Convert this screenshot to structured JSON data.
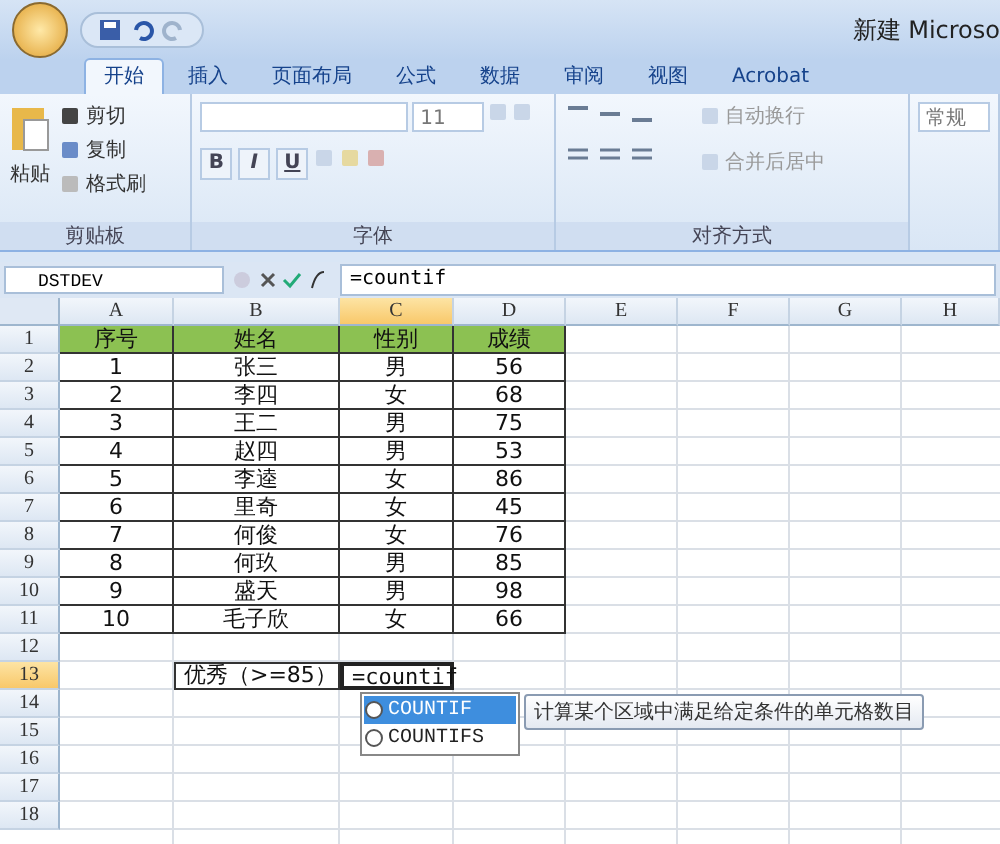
{
  "title_bar": {
    "title": "新建 Microso"
  },
  "tabs": [
    {
      "label": "开始",
      "selected": true
    },
    {
      "label": "插入",
      "selected": false
    },
    {
      "label": "页面布局",
      "selected": false
    },
    {
      "label": "公式",
      "selected": false
    },
    {
      "label": "数据",
      "selected": false
    },
    {
      "label": "审阅",
      "selected": false
    },
    {
      "label": "视图",
      "selected": false
    },
    {
      "label": "Acrobat",
      "selected": false
    }
  ],
  "ribbon": {
    "clipboard": {
      "paste": "粘贴",
      "items": [
        "剪切",
        "复制",
        "格式刷"
      ],
      "label": "剪贴板"
    },
    "font": {
      "size": "11",
      "format_buttons": [
        "B",
        "I",
        "U"
      ],
      "label": "字体"
    },
    "alignment": {
      "wrap": "自动换行",
      "merge": "合并后居中",
      "label": "对齐方式"
    },
    "number": {
      "format": "常规"
    }
  },
  "formula_bar": {
    "name_box": "DSTDEV",
    "formula": "=countif"
  },
  "columns": [
    {
      "label": "A",
      "selected": false
    },
    {
      "label": "B",
      "selected": false
    },
    {
      "label": "C",
      "selected": true
    },
    {
      "label": "D",
      "selected": false
    },
    {
      "label": "E",
      "selected": false
    },
    {
      "label": "F",
      "selected": false
    },
    {
      "label": "G",
      "selected": false
    },
    {
      "label": "H",
      "selected": false
    }
  ],
  "rows": [
    {
      "label": "1",
      "selected": false,
      "kind": "header",
      "cells": [
        "序号",
        "姓名",
        "性别",
        "成绩"
      ]
    },
    {
      "label": "2",
      "selected": false,
      "kind": "data",
      "cells": [
        "1",
        "张三",
        "男",
        "56"
      ]
    },
    {
      "label": "3",
      "selected": false,
      "kind": "data",
      "cells": [
        "2",
        "李四",
        "女",
        "68"
      ]
    },
    {
      "label": "4",
      "selected": false,
      "kind": "data",
      "cells": [
        "3",
        "王二",
        "男",
        "75"
      ]
    },
    {
      "label": "5",
      "selected": false,
      "kind": "data",
      "cells": [
        "4",
        "赵四",
        "男",
        "53"
      ]
    },
    {
      "label": "6",
      "selected": false,
      "kind": "data",
      "cells": [
        "5",
        "李逵",
        "女",
        "86"
      ]
    },
    {
      "label": "7",
      "selected": false,
      "kind": "data",
      "cells": [
        "6",
        "里奇",
        "女",
        "45"
      ]
    },
    {
      "label": "8",
      "selected": false,
      "kind": "data",
      "cells": [
        "7",
        "何俊",
        "女",
        "76"
      ]
    },
    {
      "label": "9",
      "selected": false,
      "kind": "data",
      "cells": [
        "8",
        "何玖",
        "男",
        "85"
      ]
    },
    {
      "label": "10",
      "selected": false,
      "kind": "data",
      "cells": [
        "9",
        "盛天",
        "男",
        "98"
      ]
    },
    {
      "label": "11",
      "selected": false,
      "kind": "data",
      "cells": [
        "10",
        "毛子欣",
        "女",
        "66"
      ]
    },
    {
      "label": "12",
      "selected": false,
      "kind": "empty"
    },
    {
      "label": "13",
      "selected": true,
      "kind": "entry",
      "cells": [
        "优秀（>=85）",
        "=countif"
      ]
    },
    {
      "label": "14",
      "selected": false,
      "kind": "empty"
    },
    {
      "label": "15",
      "selected": false,
      "kind": "empty"
    },
    {
      "label": "16",
      "selected": false,
      "kind": "empty"
    },
    {
      "label": "17",
      "selected": false,
      "kind": "empty"
    },
    {
      "label": "18",
      "selected": false,
      "kind": "empty"
    }
  ],
  "autocomplete": {
    "items": [
      {
        "name": "COUNTIF",
        "selected": true
      },
      {
        "name": "COUNTIFS",
        "selected": false
      }
    ],
    "tooltip": "计算某个区域中满足给定条件的单元格数目"
  }
}
